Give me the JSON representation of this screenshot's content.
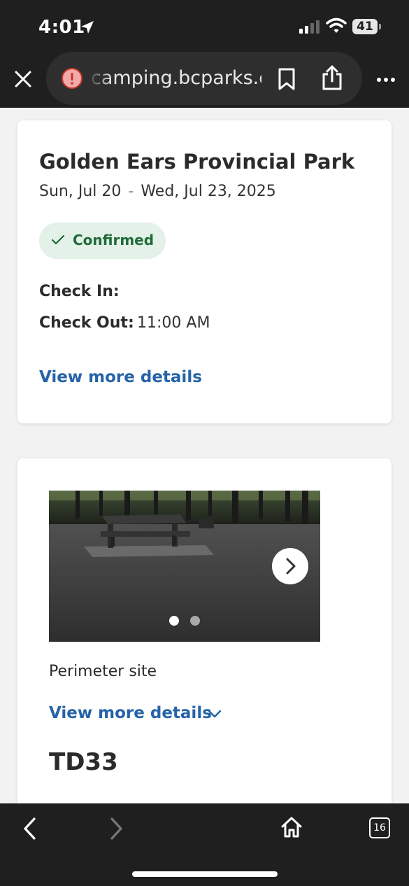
{
  "status": {
    "time": "4:01",
    "battery": "41"
  },
  "browser": {
    "url": "camping.bcparks.ca",
    "tab_count": "16"
  },
  "reservation": {
    "park": "Golden Ears Provincial Park",
    "start_date": "Sun, Jul 20",
    "separator": "-",
    "end_date": "Wed, Jul 23, 2025",
    "status": "Confirmed",
    "check_in_label": "Check In:",
    "check_in_value": "",
    "check_out_label": "Check Out:",
    "check_out_value": "11:00 AM",
    "details_link": "View more details"
  },
  "site": {
    "type": "Perimeter site",
    "details_link": "View more details",
    "id": "TD33",
    "photo_count": 2,
    "active_photo": 1
  },
  "colors": {
    "link": "#2663a8",
    "badge_bg": "#e3f1e8",
    "badge_text": "#1f6b3a",
    "chrome": "#1f1f1f"
  },
  "icons": [
    "location-arrow-icon",
    "signal-icon",
    "wifi-icon",
    "battery-icon",
    "close-icon",
    "alert-icon",
    "bookmark-icon",
    "share-icon",
    "more-icon",
    "check-icon",
    "chevron-right-icon",
    "chevron-down-icon",
    "back-icon",
    "forward-icon",
    "home-icon",
    "tabs-icon"
  ]
}
